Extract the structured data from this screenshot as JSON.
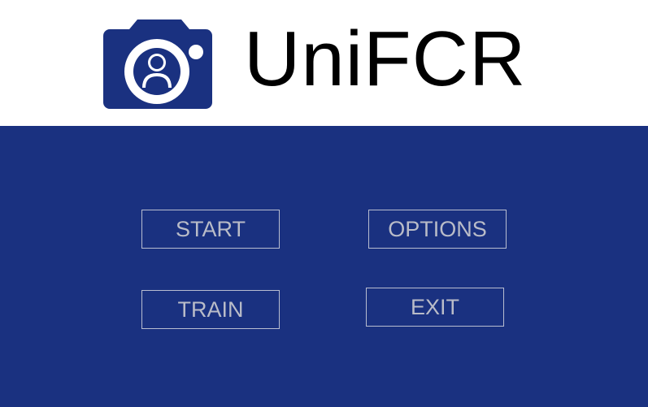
{
  "app": {
    "title": "UniFCR"
  },
  "menu": {
    "start_label": "START",
    "options_label": "OPTIONS",
    "train_label": "TRAIN",
    "exit_label": "EXIT"
  },
  "icons": {
    "logo": "camera-user-icon"
  },
  "colors": {
    "brand_blue": "#1a3180",
    "button_text": "#b9bcc8",
    "button_border": "#b8bdd0",
    "header_bg": "#ffffff"
  }
}
